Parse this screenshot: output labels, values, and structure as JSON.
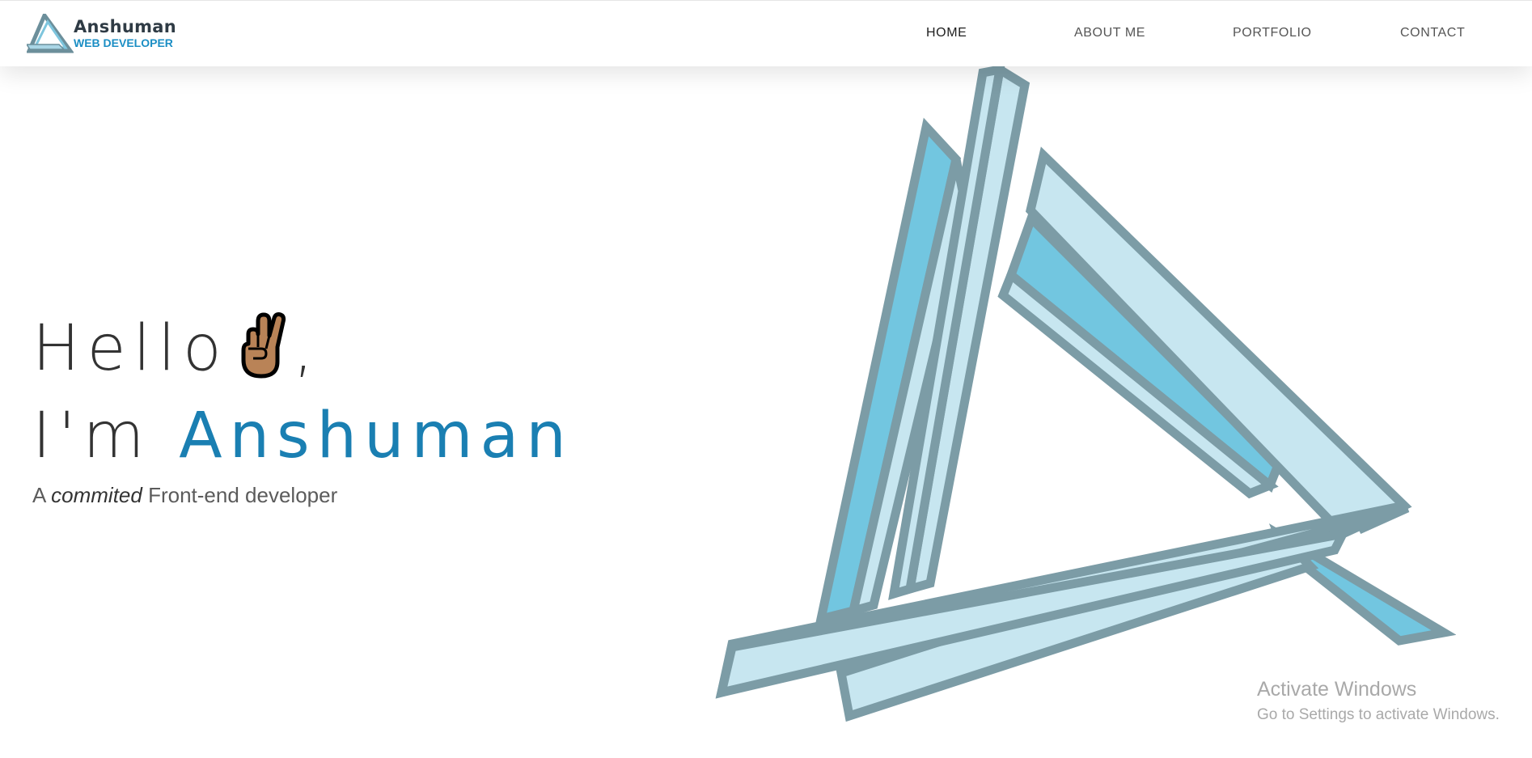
{
  "brand": {
    "name": "Anshuman",
    "subtitle": "WEB DEVELOPER"
  },
  "nav": {
    "items": [
      {
        "label": "HOME",
        "active": true
      },
      {
        "label": "ABOUT ME",
        "active": false
      },
      {
        "label": "PORTFOLIO",
        "active": false
      },
      {
        "label": "CONTACT",
        "active": false
      }
    ]
  },
  "hero": {
    "greeting": "Hello",
    "greeting_emoji": "victory-hand-icon",
    "greeting_suffix": ",",
    "intro": "I'm",
    "name": "Anshuman",
    "tagline_prefix": "A",
    "tagline_emphasis": "commited",
    "tagline_suffix": "Front-end developer"
  },
  "colors": {
    "accent": "#1a7fb2",
    "logo_blue": "#1b8ec4",
    "triangle_light": "#c7e6f0",
    "triangle_mid": "#72c6e0",
    "triangle_stroke": "#7c9ca6"
  },
  "watermark": {
    "title": "Activate Windows",
    "subtitle": "Go to Settings to activate Windows."
  }
}
